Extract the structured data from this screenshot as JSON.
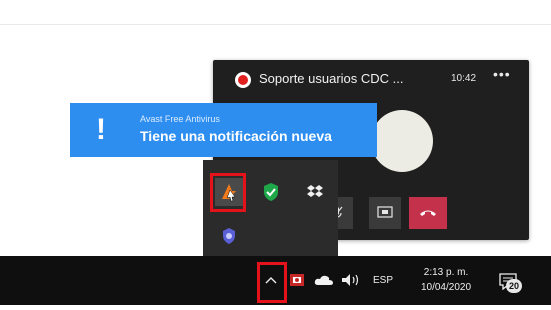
{
  "call": {
    "title": "Soporte usuarios CDC ...",
    "time": "10:42",
    "more": "•••"
  },
  "toast": {
    "app_name": "Avast Free Antivirus",
    "message": "Tiene una notificación nueva"
  },
  "tray_popup": {
    "icons": [
      "avast-icon",
      "defender-shield-icon",
      "dropbox-icon",
      "app-icon"
    ]
  },
  "taskbar": {
    "chevron": "^",
    "language": "ESP",
    "clock_time": "2:13 p. m.",
    "clock_date": "10/04/2020",
    "notification_count": "20"
  },
  "colors": {
    "toast_bg": "#2d8ef0",
    "taskbar_bg": "#0f0f0f",
    "highlight": "#e3121b",
    "hangup": "#c4314b"
  }
}
